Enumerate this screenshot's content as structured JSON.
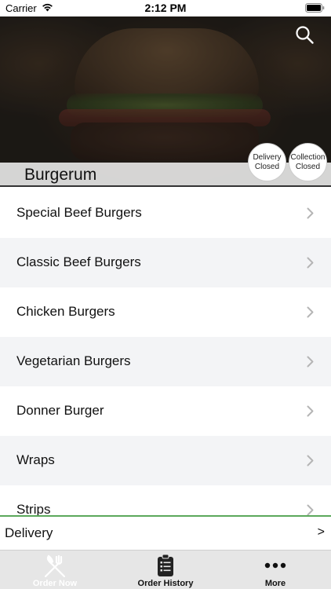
{
  "status_bar": {
    "carrier": "Carrier",
    "time": "2:12 PM"
  },
  "restaurant": {
    "name": "Burgerum"
  },
  "badges": {
    "delivery": {
      "line1": "Delivery",
      "line2": "Closed"
    },
    "collection": {
      "line1": "Collection",
      "line2": "Closed"
    }
  },
  "categories": [
    {
      "label": "Special Beef Burgers"
    },
    {
      "label": "Classic Beef Burgers"
    },
    {
      "label": "Chicken Burgers"
    },
    {
      "label": "Vegetarian Burgers"
    },
    {
      "label": "Donner Burger"
    },
    {
      "label": "Wraps"
    },
    {
      "label": "Strips"
    }
  ],
  "delivery_bar": {
    "label": "Delivery",
    "arrow": ">"
  },
  "tab_bar": {
    "tabs": [
      {
        "label": "Order Now",
        "icon": "fork-knife-icon"
      },
      {
        "label": "Order History",
        "icon": "clipboard-icon"
      },
      {
        "label": "More",
        "icon": "more-dots-icon"
      }
    ]
  },
  "colors": {
    "accent_green": "#5ba85b",
    "tab_bar_bg": "#e6e6e6",
    "alt_row_bg": "#f3f4f6"
  }
}
